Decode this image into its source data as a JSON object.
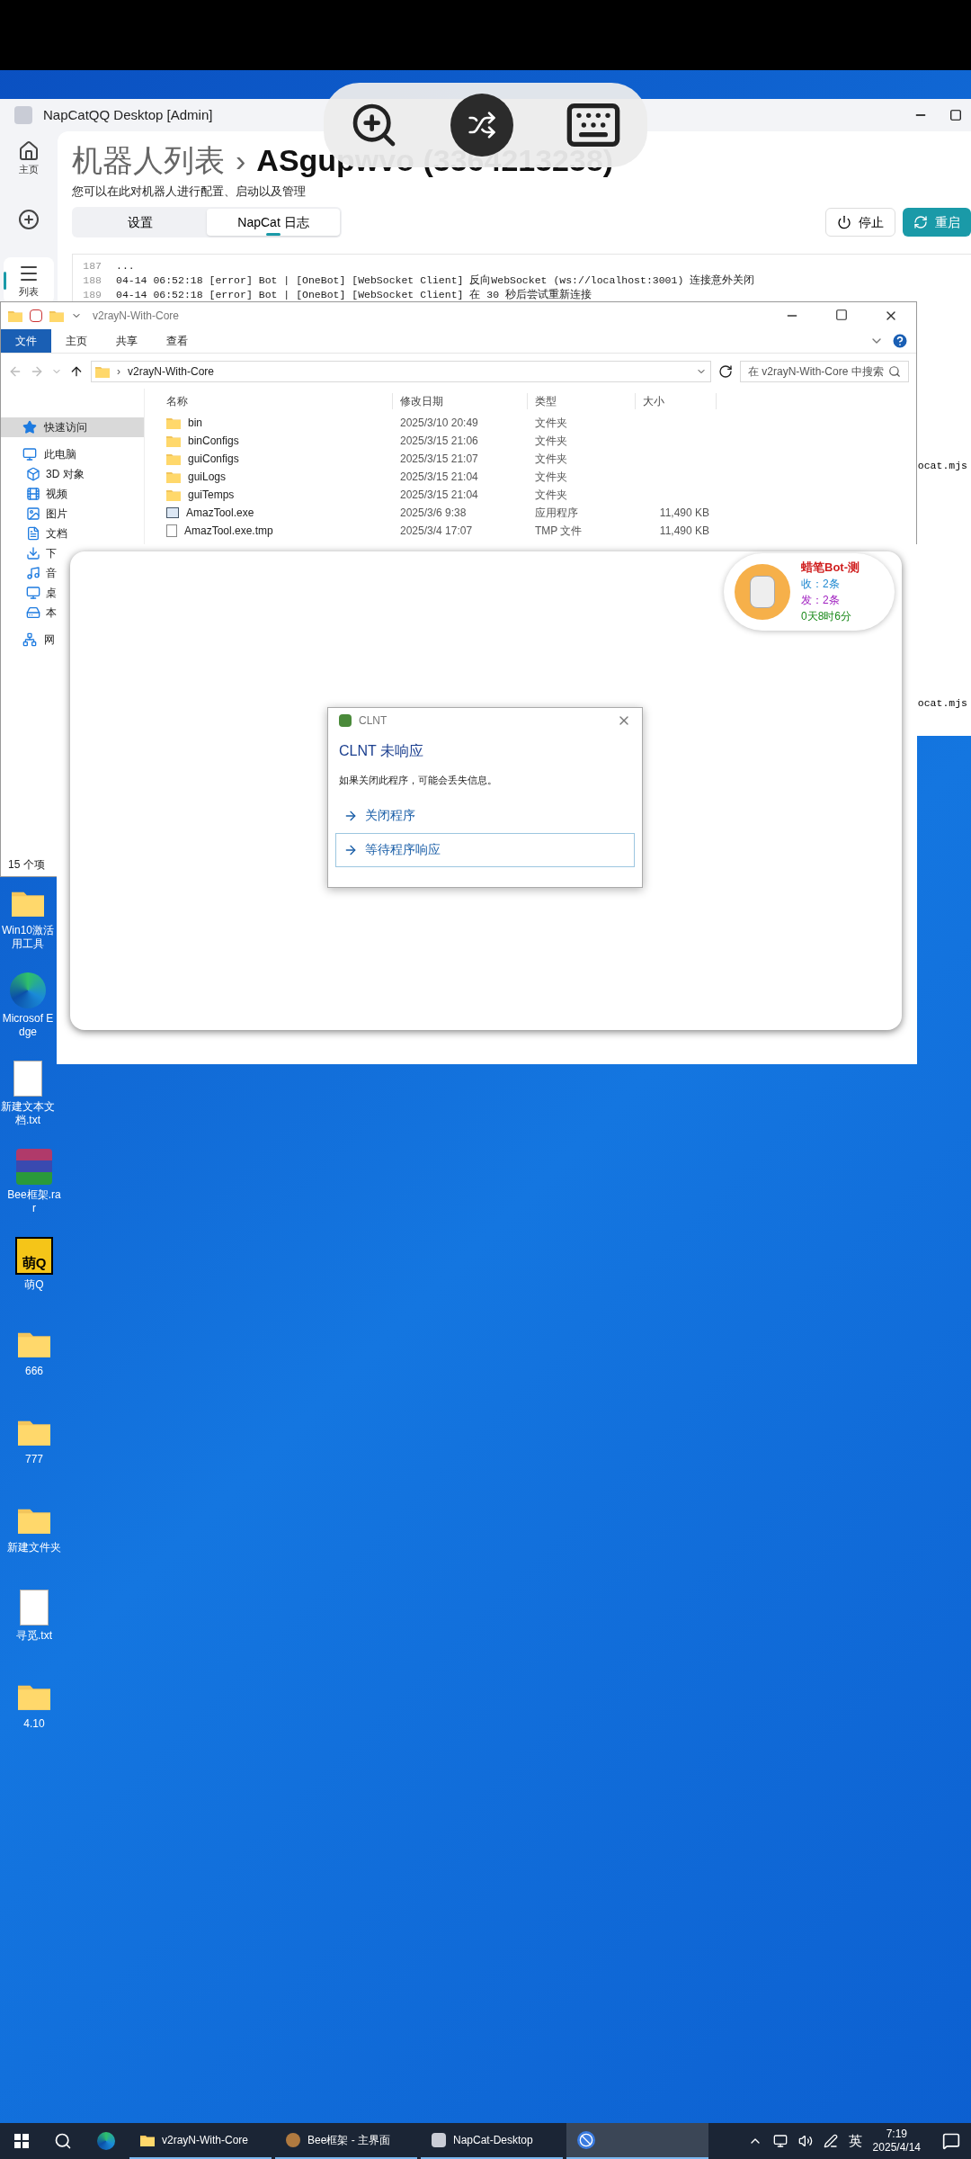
{
  "napcat": {
    "title": "NapCatQQ Desktop [Admin]",
    "sidebar": [
      {
        "label": "主页",
        "selected": false
      },
      {
        "selected": false
      },
      {
        "label": "列表",
        "selected": true
      }
    ],
    "breadcrumb_parent": "机器人列表",
    "breadcrumb_separator": "›",
    "breadcrumb_current": "ASgupwvo (3364213238)",
    "subtitle": "您可以在此对机器人进行配置、启动以及管理",
    "tabs": [
      {
        "label": "设置",
        "selected": false
      },
      {
        "label": "NapCat 日志",
        "selected": true
      }
    ],
    "buttons": [
      {
        "label": "停止",
        "kind": "stop"
      },
      {
        "label": "重启",
        "kind": "restart"
      }
    ],
    "log": [
      {
        "line": "187",
        "text": "..."
      },
      {
        "line": "188",
        "text": "04-14 06:52:18 [error] Bot | [OneBot] [WebSocket Client] 反向WebSocket (ws://localhost:3001) 连接意外关闭"
      },
      {
        "line": "189",
        "text": "04-14 06:52:18 [error] Bot | [OneBot] [WebSocket Client] 在 30 秒后尝试重新连接"
      }
    ],
    "log_fragments": [
      "ocat.mjs",
      "ocat.mjs"
    ]
  },
  "explorer": {
    "title": "v2rayN-With-Core",
    "ribbon_tabs": [
      {
        "label": "文件",
        "selected": true
      },
      {
        "label": "主页",
        "selected": false
      },
      {
        "label": "共享",
        "selected": false
      },
      {
        "label": "查看",
        "selected": false
      }
    ],
    "address_separator": "›",
    "address": "v2rayN-With-Core",
    "search_placeholder": "在 v2rayN-With-Core 中搜索",
    "columns": [
      "名称",
      "修改日期",
      "类型",
      "大小"
    ],
    "nav": [
      {
        "label": "快速访问",
        "selected": true
      },
      {
        "label": "此电脑",
        "selected": false,
        "children": [
          {
            "label": "3D 对象",
            "selected": false
          },
          {
            "label": "视频",
            "selected": false
          },
          {
            "label": "图片",
            "selected": false
          },
          {
            "label": "文档",
            "selected": false
          },
          {
            "label": "下",
            "selected": false
          },
          {
            "label": "音",
            "selected": false
          },
          {
            "label": "桌",
            "selected": false
          },
          {
            "label": "本",
            "selected": false
          }
        ]
      },
      {
        "label": "网",
        "selected": false
      }
    ],
    "files": [
      {
        "name": "bin",
        "kind": "folder",
        "date": "2025/3/10 20:49",
        "type": "文件夹"
      },
      {
        "name": "binConfigs",
        "kind": "folder",
        "date": "2025/3/15 21:06",
        "type": "文件夹"
      },
      {
        "name": "guiConfigs",
        "kind": "folder",
        "date": "2025/3/15 21:07",
        "type": "文件夹"
      },
      {
        "name": "guiLogs",
        "kind": "folder",
        "date": "2025/3/15 21:04",
        "type": "文件夹"
      },
      {
        "name": "guiTemps",
        "kind": "folder",
        "date": "2025/3/15 21:04",
        "type": "文件夹"
      },
      {
        "name": "AmazTool.exe",
        "kind": "app",
        "date": "2025/3/6 9:38",
        "type": "应用程序",
        "size": "11,490 KB"
      },
      {
        "name": "AmazTool.exe.tmp",
        "kind": "file",
        "date": "2025/3/4 17:07",
        "type": "TMP 文件",
        "size": "11,490 KB"
      }
    ],
    "status": "15 个项"
  },
  "bot_card": {
    "name": "蜡笔Bot-测",
    "received": "收：2条",
    "sent": "发：2条",
    "uptime": "0天8时6分"
  },
  "dialog": {
    "title": "CLNT",
    "heading": "CLNT 未响应",
    "message": "如果关闭此程序，可能会丢失信息。",
    "options": [
      {
        "label": "关闭程序",
        "selected": false
      },
      {
        "label": "等待程序响应",
        "selected": true
      }
    ]
  },
  "desktop_icons": [
    {
      "label": "Win10激活用工具",
      "kind": "folder"
    },
    {
      "label": "Microsof Edge",
      "kind": "edge"
    },
    {
      "label": "新建文本文档.txt",
      "kind": "text"
    },
    {
      "label": "Bee框架.rar",
      "kind": "archive"
    },
    {
      "label": "萌Q",
      "kind": "app",
      "glyph": "萌Q"
    },
    {
      "label": "666",
      "kind": "folder"
    },
    {
      "label": "777",
      "kind": "folder"
    },
    {
      "label": "新建文件夹",
      "kind": "folder"
    },
    {
      "label": "寻觅.txt",
      "kind": "text"
    },
    {
      "label": "4.10",
      "kind": "folder"
    }
  ],
  "taskbar": {
    "apps": [
      {
        "label": "v2rayN-With-Core",
        "kind": "folder",
        "selected": false
      },
      {
        "label": "Bee框架 - 主界面",
        "kind": "bee",
        "selected": false
      },
      {
        "label": "NapCat-Desktop",
        "kind": "napcat",
        "selected": false
      },
      {
        "kind": "blue",
        "selected": true
      }
    ],
    "ime": "英",
    "time": "7:19",
    "date": "2025/4/14"
  }
}
